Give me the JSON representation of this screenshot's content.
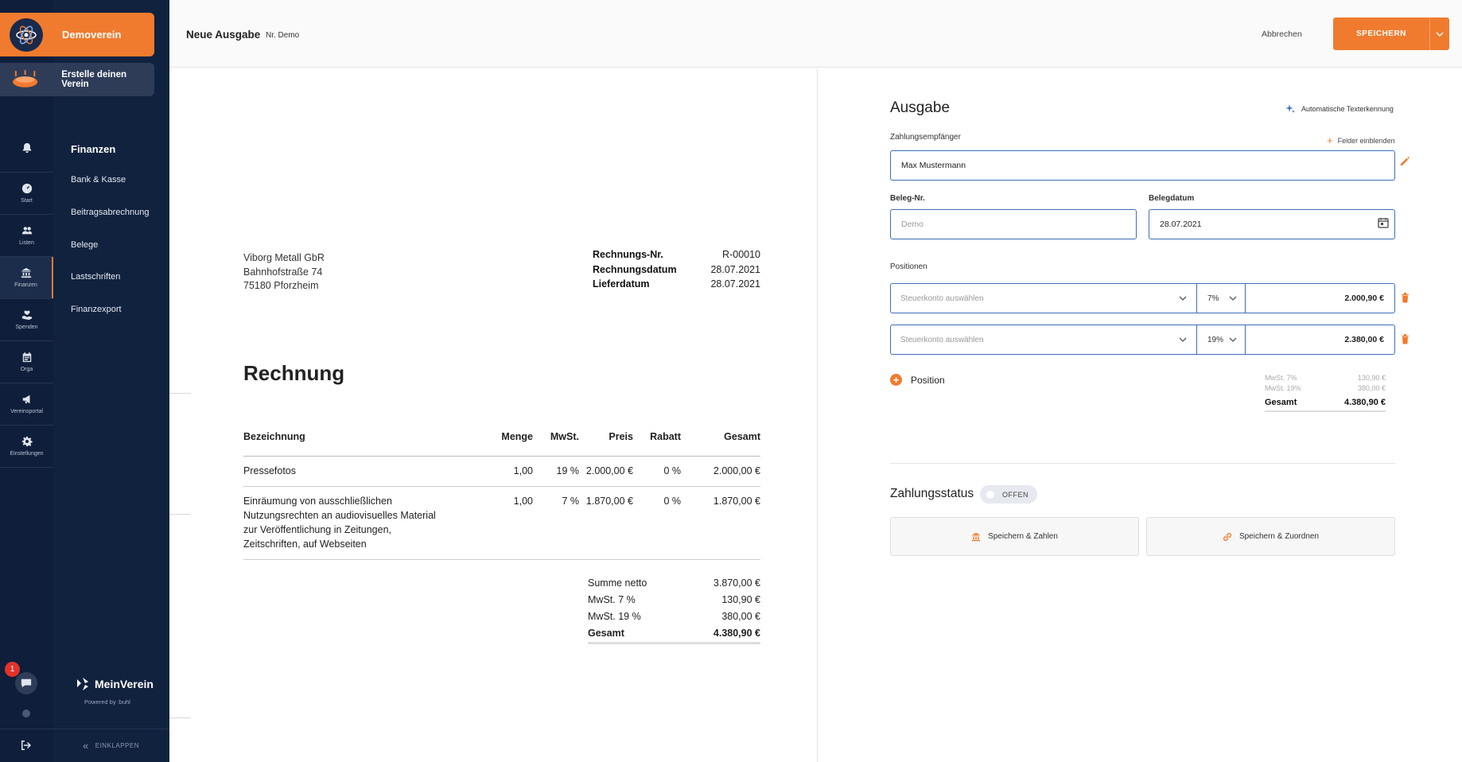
{
  "club": {
    "name": "Demoverein",
    "create_label": "Erstelle deinen Verein"
  },
  "rail": {
    "items": [
      {
        "label": "Start"
      },
      {
        "label": "Listen"
      },
      {
        "label": "Finanzen"
      },
      {
        "label": "Spenden"
      },
      {
        "label": "Orga"
      },
      {
        "label": "Vereinsportal"
      },
      {
        "label": "Einstellungen"
      }
    ],
    "badge_count": "1"
  },
  "subnav": {
    "title": "Finanzen",
    "items": [
      "Bank & Kasse",
      "Beitragsabrechnung",
      "Belege",
      "Lastschriften",
      "Finanzexport"
    ],
    "brand": "MeinVerein",
    "powered": "Powered by :buhl",
    "collapse": "EINKLAPPEN"
  },
  "header": {
    "title": "Neue Ausgabe",
    "subtitle": "Nr. Demo",
    "cancel": "Abbrechen",
    "save": "SPEICHERN"
  },
  "document": {
    "sender": [
      "Viborg Metall GbR",
      "Bahnhofstraße 74",
      "75180 Pforzheim"
    ],
    "meta": [
      {
        "k": "Rechnungs-Nr.",
        "v": "R-00010"
      },
      {
        "k": "Rechnungsdatum",
        "v": "28.07.2021"
      },
      {
        "k": "Lieferdatum",
        "v": "28.07.2021"
      }
    ],
    "title": "Rechnung",
    "columns": [
      "Bezeichnung",
      "Menge",
      "MwSt.",
      "Preis",
      "Rabatt",
      "Gesamt"
    ],
    "rows": [
      {
        "desc": "Pressefotos",
        "qty": "1,00",
        "tax": "19 %",
        "price": "2.000,00 €",
        "disc": "0 %",
        "total": "2.000,00 €"
      },
      {
        "desc": "Einräumung von ausschließlichen Nutzungsrechten an audiovisuelles Material zur Veröffentlichung in Zeitungen, Zeitschriften, auf Webseiten",
        "qty": "1,00",
        "tax": "7 %",
        "price": "1.870,00 €",
        "disc": "0 %",
        "total": "1.870,00 €"
      }
    ],
    "sums": [
      {
        "k": "Summe netto",
        "v": "3.870,00 €"
      },
      {
        "k": "MwSt. 7 %",
        "v": "130,90 €"
      },
      {
        "k": "MwSt. 19 %",
        "v": "380,00 €"
      },
      {
        "k": "Gesamt",
        "v": "4.380,90 €"
      }
    ]
  },
  "form": {
    "title": "Ausgabe",
    "ocr": "Automatische Texterkennung",
    "payee_label": "Zahlungsempfänger",
    "fields_toggle": "Felder einblenden",
    "payee_value": "Max Mustermann",
    "receipt_no_label": "Beleg-Nr.",
    "receipt_no_placeholder": "Demo",
    "receipt_date_label": "Belegdatum",
    "receipt_date_value": "28.07.2021",
    "positions_label": "Positionen",
    "positions": [
      {
        "account_placeholder": "Steuerkonto auswählen",
        "tax": "7%",
        "amount": "2.000,90 €"
      },
      {
        "account_placeholder": "Steuerkonto auswählen",
        "tax": "19%",
        "amount": "2.380,00 €"
      }
    ],
    "add_position": "Position",
    "tax_summary": [
      {
        "k": "MwSt. 7%",
        "v": "130,90 €"
      },
      {
        "k": "MwSt. 19%",
        "v": "380,00 €"
      }
    ],
    "total_label": "Gesamt",
    "total_value": "4.380,90 €",
    "payment_status_label": "Zahlungsstatus",
    "payment_status": "OFFEN",
    "save_pay": "Speichern & Zahlen",
    "save_assign": "Speichern & Zuordnen"
  },
  "colors": {
    "accent": "#f07b2e",
    "sidebar": "#0f1e3a",
    "input_border": "#3d6fb8"
  }
}
